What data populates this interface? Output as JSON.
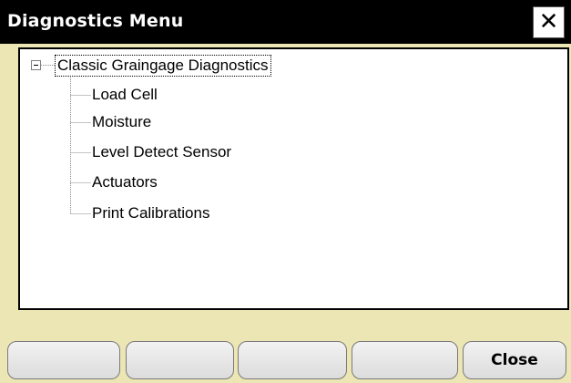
{
  "window": {
    "title": "Diagnostics Menu",
    "close_glyph": "✕"
  },
  "tree": {
    "root": {
      "label": "Classic Graingage Diagnostics",
      "expanded": true,
      "selected": true,
      "children": [
        {
          "label": "Load Cell"
        },
        {
          "label": "Moisture"
        },
        {
          "label": "Level Detect Sensor"
        },
        {
          "label": "Actuators"
        },
        {
          "label": "Print Calibrations"
        }
      ]
    }
  },
  "buttons": [
    {
      "label": ""
    },
    {
      "label": ""
    },
    {
      "label": ""
    },
    {
      "label": ""
    },
    {
      "label": "Close"
    }
  ],
  "colors": {
    "titlebar": "#000000",
    "background": "#ebe6b4",
    "tree_background": "#ffffff"
  }
}
